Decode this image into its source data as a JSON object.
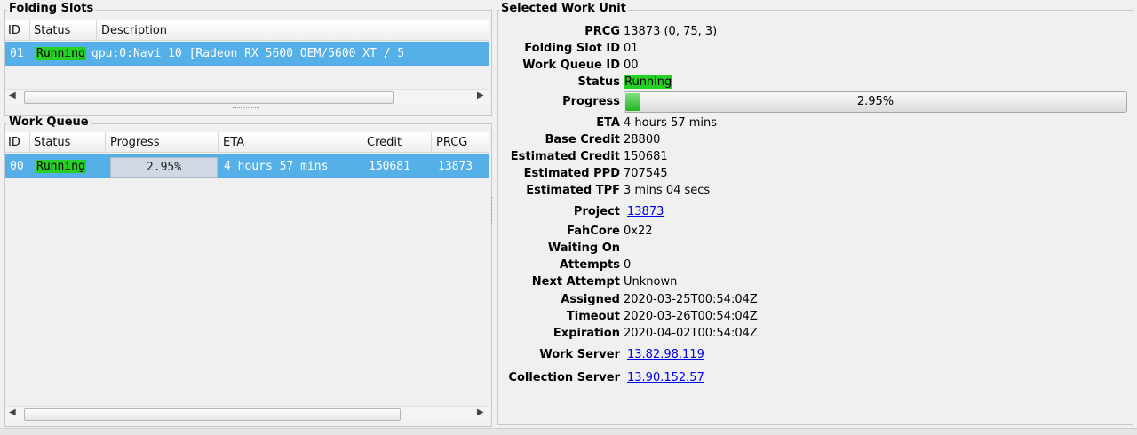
{
  "folding_slots": {
    "title": "Folding Slots",
    "columns": [
      "ID",
      "Status",
      "Description"
    ],
    "rows": [
      {
        "id": "01",
        "status": "Running",
        "description": "gpu:0:Navi 10 [Radeon RX 5600 OEM/5600 XT / 5"
      }
    ]
  },
  "work_queue": {
    "title": "Work Queue",
    "columns": [
      "ID",
      "Status",
      "Progress",
      "ETA",
      "Credit",
      "PRCG"
    ],
    "rows": [
      {
        "id": "00",
        "status": "Running",
        "progress": "2.95%",
        "eta": "4 hours 57 mins",
        "credit": "150681",
        "prcg": "13873"
      }
    ]
  },
  "selected_work_unit": {
    "title": "Selected Work Unit",
    "fields": [
      {
        "label": "PRCG",
        "value": "13873 (0, 75, 3)"
      },
      {
        "label": "Folding Slot ID",
        "value": "01"
      },
      {
        "label": "Work Queue ID",
        "value": "00"
      },
      {
        "label": "Status",
        "value": "Running"
      },
      {
        "label": "Progress",
        "value": "2.95%"
      },
      {
        "label": "ETA",
        "value": "4 hours 57 mins"
      },
      {
        "label": "Base Credit",
        "value": "28800"
      },
      {
        "label": "Estimated Credit",
        "value": "150681"
      },
      {
        "label": "Estimated PPD",
        "value": "707545"
      },
      {
        "label": "Estimated TPF",
        "value": "3 mins 04 secs"
      },
      {
        "label": "Project",
        "value": "13873"
      },
      {
        "label": "FahCore",
        "value": "0x22"
      },
      {
        "label": "Waiting On",
        "value": ""
      },
      {
        "label": "Attempts",
        "value": "0"
      },
      {
        "label": "Next Attempt",
        "value": "Unknown"
      },
      {
        "label": "Assigned",
        "value": "2020-03-25T00:54:04Z"
      },
      {
        "label": "Timeout",
        "value": "2020-03-26T00:54:04Z"
      },
      {
        "label": "Expiration",
        "value": "2020-04-02T00:54:04Z"
      },
      {
        "label": "Work Server",
        "value": "13.82.98.119"
      },
      {
        "label": "Collection Server",
        "value": "13.90.152.57"
      }
    ],
    "progress_fraction": 0.0295
  },
  "colors": {
    "selection": "#55b0e8",
    "running": "#26d026",
    "link": "#0000ee"
  },
  "icons": {
    "scroll_left": "arrow-left-icon",
    "scroll_right": "arrow-right-icon"
  }
}
